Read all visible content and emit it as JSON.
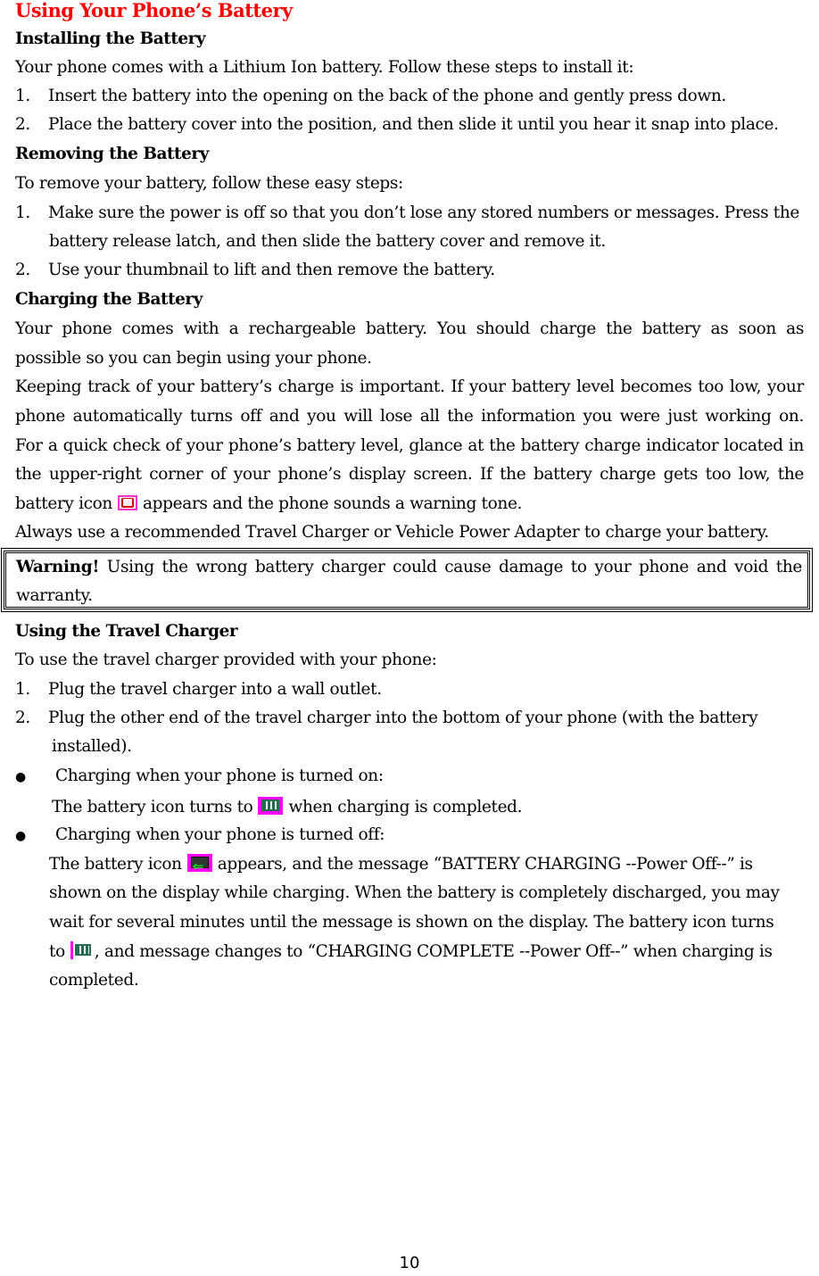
{
  "document": {
    "title": "Using Your Phone’s Battery",
    "page_number": "10",
    "sections": {
      "installing": {
        "heading": "Installing the Battery",
        "intro": "Your phone comes with a Lithium Ion battery. Follow these steps to install it:",
        "steps": [
          {
            "num": "1.",
            "text": "Insert the battery into the opening on the back of the phone and gently press down."
          },
          {
            "num": "2.",
            "text": "Place the battery cover into the position, and then slide it until you hear it snap into place."
          }
        ]
      },
      "removing": {
        "heading": "Removing the Battery",
        "intro": "To remove your battery, follow these easy steps:",
        "steps": [
          {
            "num": "1.",
            "text": "Make sure the power is off so that you don’t lose any stored numbers or messages. Press the",
            "cont": "battery release latch, and then slide the battery cover and remove it."
          },
          {
            "num": "2.",
            "text": "Use your thumbnail to lift and then remove the battery."
          }
        ]
      },
      "charging": {
        "heading": "Charging the Battery",
        "para1_line1": "Your phone comes with a rechargeable battery. You should charge the battery as soon as",
        "para1_line2": "possible so you can begin using your phone.",
        "para2_line1": "Keeping track of your battery’s charge is important. If your battery level becomes too low, your",
        "para2_line2": "phone automatically turns off and you will lose all the information you were just working on.",
        "para3_line1": "For a quick check of your phone’s battery level, glance at the battery charge indicator located in",
        "para3_line2": "the upper-right corner of your phone’s display screen. If the battery charge gets too low, the",
        "para3_line3_before": "battery icon",
        "para3_line3_icon": "battery-empty-icon",
        "para3_line3_after": "appears and the phone sounds a warning tone.",
        "para4": "Always use a recommended Travel Charger or Vehicle Power Adapter to charge your battery."
      },
      "warning": {
        "label": "Warning!",
        "line1": "Using the wrong battery charger could cause damage to your phone and void the",
        "line2": "warranty."
      },
      "travel_charger": {
        "heading": "Using the Travel Charger",
        "intro": "To use the travel charger provided with your phone:",
        "steps": [
          {
            "num": "1.",
            "text": "Plug the travel charger into a wall outlet."
          },
          {
            "num": "2.",
            "text": "Plug the other end of the travel charger into the bottom of your phone (with the battery",
            "cont": "installed)."
          }
        ],
        "bullets": [
          {
            "marker": "●",
            "title": "Charging when your phone is turned on:",
            "line1_before": "The battery icon turns to",
            "line1_icon": "battery-full-icon",
            "line1_after": "when charging is completed."
          },
          {
            "marker": "●",
            "title": "Charging when your phone is turned off:",
            "line1_before": "The battery icon",
            "line1_icon": "battery-charging-icon",
            "line1_after": "appears, and the message “BATTERY CHARGING --Power Off--” is",
            "line2": "shown on the display while charging. When the battery is completely discharged, you may",
            "line3": "wait for several minutes until the message is shown on the display. The battery icon turns",
            "line4_before": "to",
            "line4_icon": "battery-full-icon",
            "line4_after": ", and message changes to “CHARGING COMPLETE --Power Off--” when charging is",
            "line5": "completed."
          }
        ]
      }
    }
  }
}
